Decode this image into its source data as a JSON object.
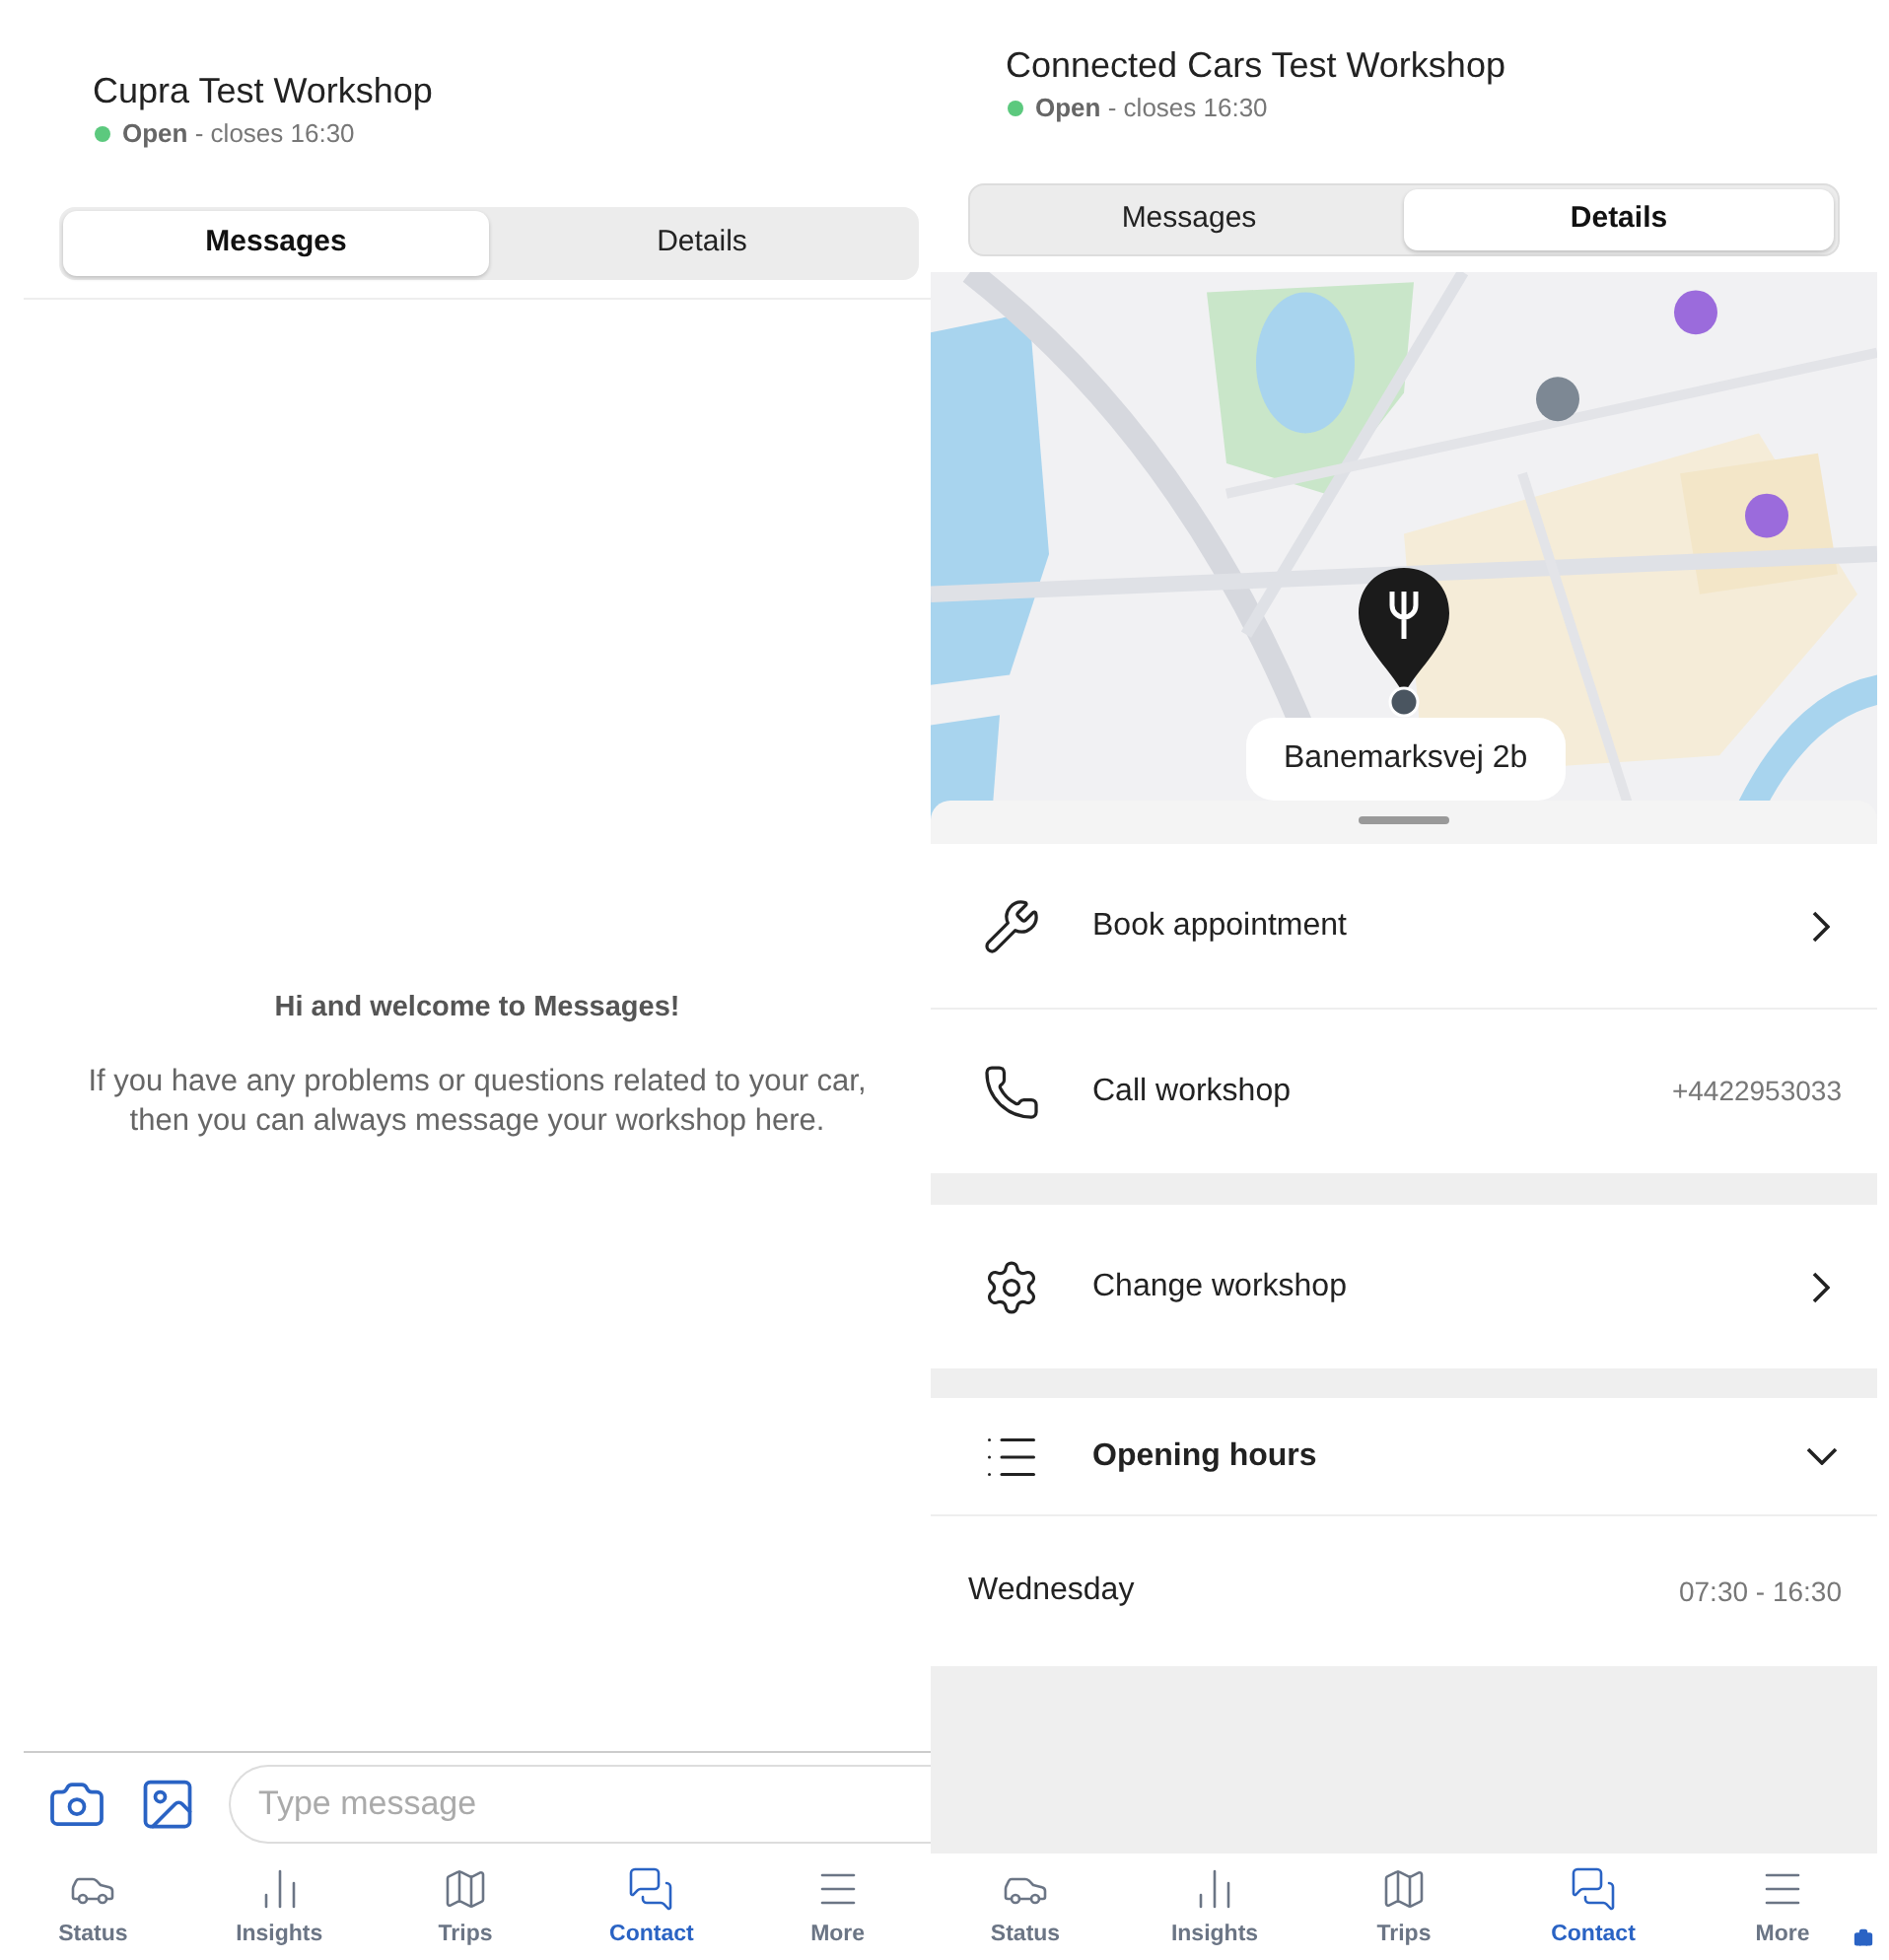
{
  "screens": [
    {
      "kind": "messages",
      "workshop": {
        "name": "Cupra Test Workshop",
        "status": "Open",
        "closes": "- closes 16:30",
        "open": true
      },
      "tabs": [
        {
          "label": "Messages",
          "selected": true
        },
        {
          "label": "Details",
          "selected": false
        }
      ],
      "welcome": {
        "title": "Hi and welcome to Messages!",
        "body": "If you have any problems or questions related to your car, then you can always message your workshop here."
      },
      "composer": {
        "placeholder": "Type message"
      },
      "nav": [
        {
          "label": "Status",
          "selected": false
        },
        {
          "label": "Insights",
          "selected": false
        },
        {
          "label": "Trips",
          "selected": false
        },
        {
          "label": "Contact",
          "selected": true
        },
        {
          "label": "More",
          "selected": false
        }
      ]
    },
    {
      "kind": "details",
      "workshop": {
        "name": "Connected Cars Test Workshop",
        "status": "Open",
        "closes": "- closes 16:30",
        "open": true
      },
      "tabs": [
        {
          "label": "Messages",
          "selected": false
        },
        {
          "label": "Details",
          "selected": true
        }
      ],
      "map": {
        "address": "Banemarksvej 2b"
      },
      "actions": [
        {
          "label": "Book appointment",
          "kind": "link"
        },
        {
          "label": "Call workshop",
          "kind": "value",
          "value": "+4422953033"
        },
        {
          "label": "Change workshop",
          "kind": "link"
        }
      ],
      "opening_hours": {
        "label": "Opening hours",
        "expanded": true,
        "days": [
          {
            "day": "Wednesday",
            "hours": "07:30 - 16:30"
          }
        ]
      },
      "nav": [
        {
          "label": "Status",
          "selected": false
        },
        {
          "label": "Insights",
          "selected": false
        },
        {
          "label": "Trips",
          "selected": false
        },
        {
          "label": "Contact",
          "selected": true
        },
        {
          "label": "More",
          "selected": false
        }
      ]
    }
  ]
}
